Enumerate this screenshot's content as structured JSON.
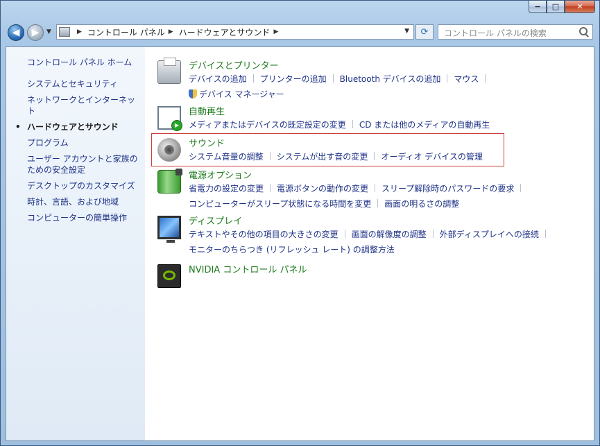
{
  "window": {
    "caption_buttons": {
      "minimize": "−",
      "maximize": "□",
      "close": "✕"
    }
  },
  "toolbar": {
    "breadcrumb": [
      "コントロール パネル",
      "ハードウェアとサウンド"
    ],
    "search_placeholder": "コントロール パネルの検索"
  },
  "sidebar": {
    "home": "コントロール パネル ホーム",
    "items": [
      {
        "label": "システムとセキュリティ",
        "active": false
      },
      {
        "label": "ネットワークとインターネット",
        "active": false
      },
      {
        "label": "ハードウェアとサウンド",
        "active": true
      },
      {
        "label": "プログラム",
        "active": false
      },
      {
        "label": "ユーザー アカウントと家族のための安全設定",
        "active": false
      },
      {
        "label": "デスクトップのカスタマイズ",
        "active": false
      },
      {
        "label": "時計、言語、および地域",
        "active": false
      },
      {
        "label": "コンピューターの簡単操作",
        "active": false
      }
    ]
  },
  "categories": {
    "devices": {
      "title": "デバイスとプリンター",
      "links": [
        "デバイスの追加",
        "プリンターの追加",
        "Bluetooth デバイスの追加",
        "マウス",
        "デバイス マネージャー"
      ]
    },
    "autoplay": {
      "title": "自動再生",
      "links": [
        "メディアまたはデバイスの既定設定の変更",
        "CD または他のメディアの自動再生"
      ]
    },
    "sound": {
      "title": "サウンド",
      "links": [
        "システム音量の調整",
        "システムが出す音の変更",
        "オーディオ デバイスの管理"
      ]
    },
    "power": {
      "title": "電源オプション",
      "links": [
        "省電力の設定の変更",
        "電源ボタンの動作の変更",
        "スリープ解除時のパスワードの要求",
        "コンピューターがスリープ状態になる時間を変更",
        "画面の明るさの調整"
      ]
    },
    "display": {
      "title": "ディスプレイ",
      "links": [
        "テキストやその他の項目の大きさの変更",
        "画面の解像度の調整",
        "外部ディスプレイへの接続",
        "モニターのちらつき (リフレッシュ レート) の調整方法"
      ]
    },
    "nvidia": {
      "title": "NVIDIA コントロール パネル"
    }
  },
  "colors": {
    "category_title": "#1e7a1e",
    "link": "#1e3287",
    "highlight_border": "#cf3d3d"
  }
}
